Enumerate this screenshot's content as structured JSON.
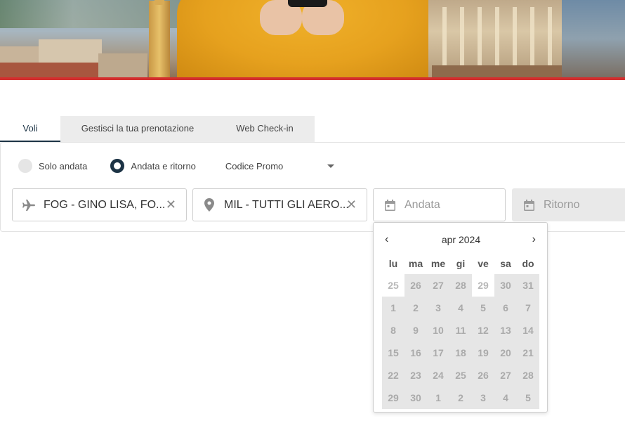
{
  "tabs": [
    {
      "label": "Voli"
    },
    {
      "label": "Gestisci la tua prenotazione"
    },
    {
      "label": "Web Check-in"
    }
  ],
  "trip_type": {
    "one_way": "Solo andata",
    "round_trip": "Andata e ritorno",
    "selected": "round_trip"
  },
  "promo": {
    "label": "Codice Promo"
  },
  "fields": {
    "origin": {
      "value": "FOG - GINO LISA, FO...",
      "icon": "plane-icon"
    },
    "destination": {
      "value": "MIL - TUTTI GLI AERO...",
      "icon": "map-pin-icon"
    },
    "departure": {
      "placeholder": "Andata",
      "icon": "calendar-icon"
    },
    "return": {
      "placeholder": "Ritorno",
      "icon": "calendar-icon"
    }
  },
  "calendar": {
    "prev": "‹",
    "next": "›",
    "month_label": "apr  2024",
    "weekdays": [
      "lu",
      "ma",
      "me",
      "gi",
      "ve",
      "sa",
      "do"
    ],
    "weeks": [
      [
        "25",
        "26",
        "27",
        "28",
        "29",
        "30",
        "31"
      ],
      [
        "1",
        "2",
        "3",
        "4",
        "5",
        "6",
        "7"
      ],
      [
        "8",
        "9",
        "10",
        "11",
        "12",
        "13",
        "14"
      ],
      [
        "15",
        "16",
        "17",
        "18",
        "19",
        "20",
        "21"
      ],
      [
        "22",
        "23",
        "24",
        "25",
        "26",
        "27",
        "28"
      ],
      [
        "29",
        "30",
        "1",
        "2",
        "3",
        "4",
        "5"
      ]
    ],
    "other_month_cells": [
      [
        0,
        0
      ],
      [
        0,
        4
      ]
    ]
  },
  "colors": {
    "accent": "#1c3345",
    "brand_red": "#d32f2f"
  }
}
